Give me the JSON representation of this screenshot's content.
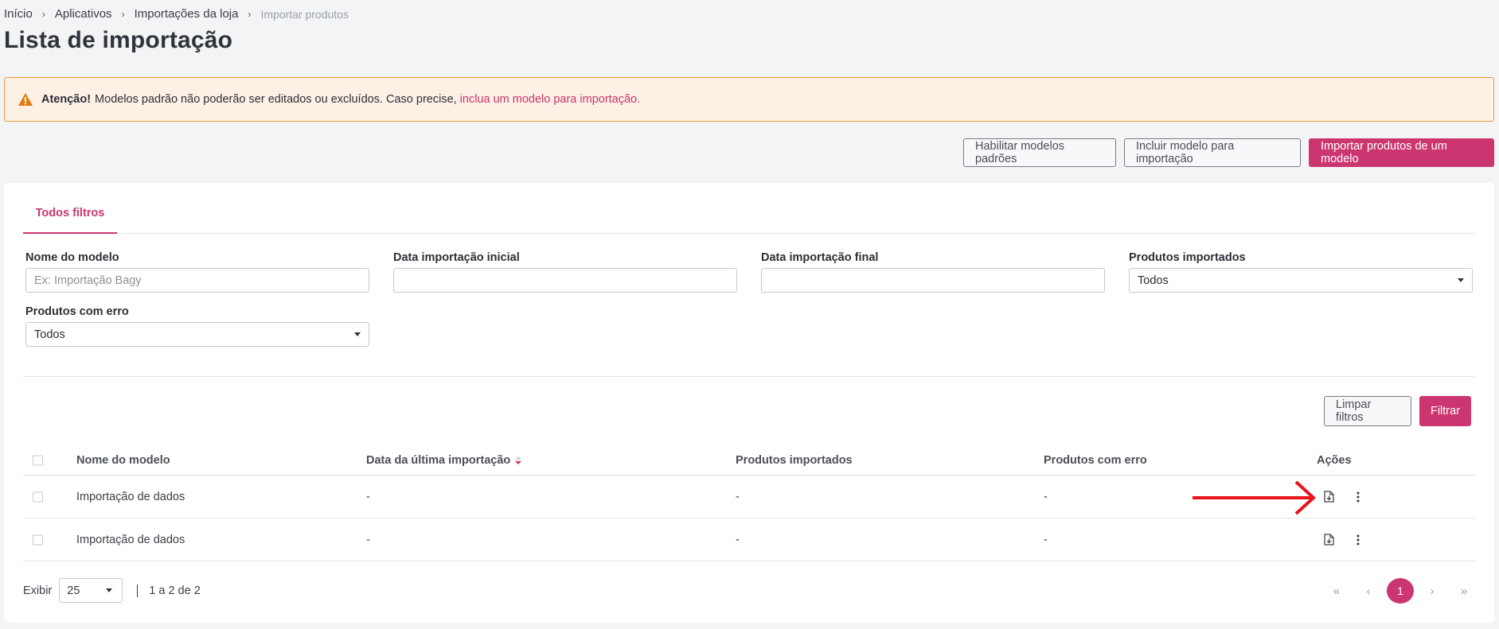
{
  "breadcrumb": {
    "items": [
      "Início",
      "Aplicativos",
      "Importações da loja"
    ],
    "current": "Importar produtos"
  },
  "page": {
    "title": "Lista de importação"
  },
  "alert": {
    "icon": "warning-icon",
    "strong": "Atenção!",
    "text": "Modelos padrão não poderão ser editados ou excluídos. Caso precise,",
    "link": "inclua um modelo para importação."
  },
  "top_actions": {
    "enable_defaults": "Habilitar modelos padrões",
    "include_model": "Incluir modelo para importação",
    "import_from_model": "Importar produtos de um modelo"
  },
  "tabs": [
    {
      "label": "Todos filtros",
      "active": true
    }
  ],
  "filters": {
    "model_name": {
      "label": "Nome do modelo",
      "placeholder": "Ex: Importação Bagy",
      "value": ""
    },
    "start_date": {
      "label": "Data importação inicial",
      "value": ""
    },
    "end_date": {
      "label": "Data importação final",
      "value": ""
    },
    "imported_products": {
      "label": "Produtos importados",
      "value": "Todos"
    },
    "error_products": {
      "label": "Produtos com erro",
      "value": "Todos"
    }
  },
  "filter_actions": {
    "clear": "Limpar filtros",
    "filter": "Filtrar"
  },
  "table": {
    "columns": [
      "Nome do modelo",
      "Data da última importação",
      "Produtos importados",
      "Produtos com erro",
      "Ações"
    ],
    "rows": [
      [
        "Importação de dados",
        "-",
        "-",
        "-"
      ],
      [
        "Importação de dados",
        "-",
        "-",
        "-"
      ]
    ]
  },
  "pagination": {
    "show_label": "Exibir",
    "page_size": "25",
    "range": "1 a 2 de 2",
    "first": "«",
    "prev": "‹",
    "current_page": "1",
    "next": "›",
    "last": "»"
  },
  "colors": {
    "accent": "#cc3670",
    "alert_bg": "#fdf1e6",
    "alert_border": "#e89a3c",
    "annotation": "#e8141b"
  }
}
